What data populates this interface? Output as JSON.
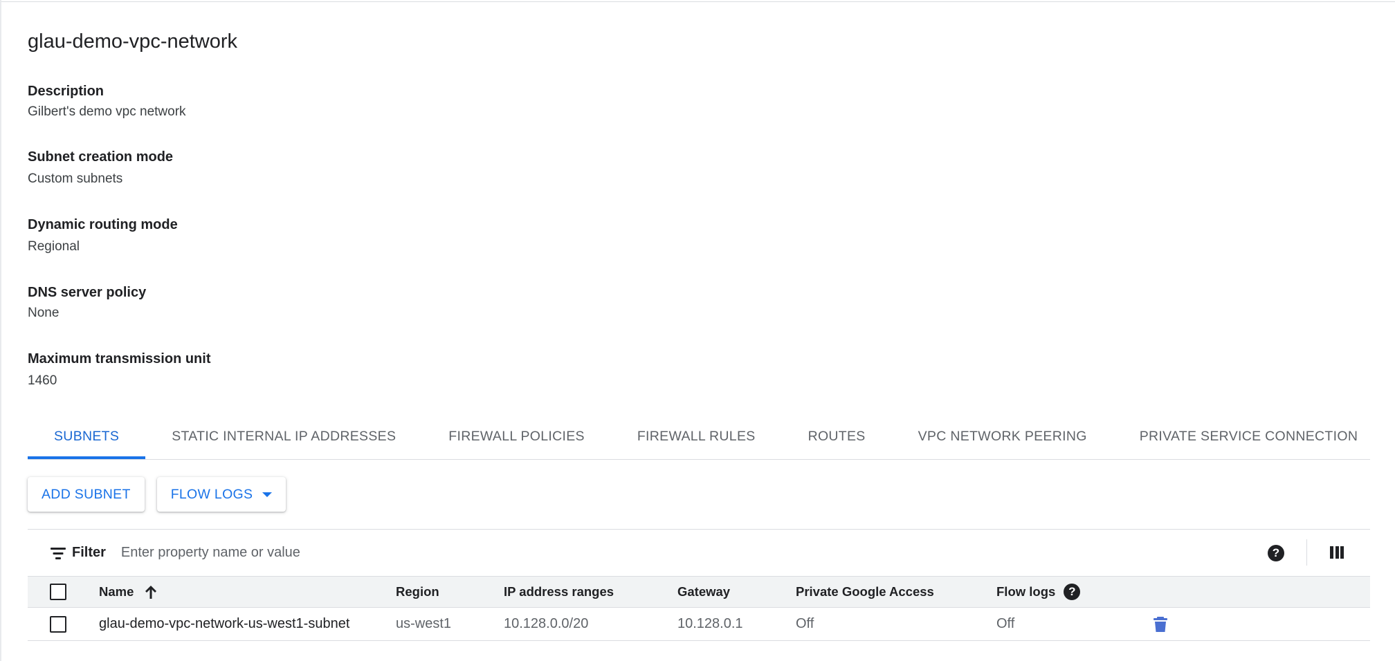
{
  "page": {
    "title": "glau-demo-vpc-network"
  },
  "properties": [
    {
      "label": "Description",
      "value": "Gilbert's demo vpc network"
    },
    {
      "label": "Subnet creation mode",
      "value": "Custom subnets"
    },
    {
      "label": "Dynamic routing mode",
      "value": "Regional"
    },
    {
      "label": "DNS server policy",
      "value": "None"
    },
    {
      "label": "Maximum transmission unit",
      "value": "1460"
    }
  ],
  "tabs": [
    {
      "label": "SUBNETS",
      "active": true
    },
    {
      "label": "STATIC INTERNAL IP ADDRESSES",
      "active": false
    },
    {
      "label": "FIREWALL POLICIES",
      "active": false
    },
    {
      "label": "FIREWALL RULES",
      "active": false
    },
    {
      "label": "ROUTES",
      "active": false
    },
    {
      "label": "VPC NETWORK PEERING",
      "active": false
    },
    {
      "label": "PRIVATE SERVICE CONNECTION",
      "active": false
    }
  ],
  "actions": {
    "add_subnet": "ADD SUBNET",
    "flow_logs": "FLOW LOGS"
  },
  "filter": {
    "label": "Filter",
    "placeholder": "Enter property name or value",
    "help_glyph": "?",
    "help_icon": "help-circle-icon",
    "columns_icon": "column-display-icon"
  },
  "table": {
    "columns": {
      "name": "Name",
      "region": "Region",
      "ip_ranges": "IP address ranges",
      "gateway": "Gateway",
      "private_google_access": "Private Google Access",
      "flow_logs": "Flow logs"
    },
    "sort": {
      "column": "name",
      "direction": "ascending",
      "icon": "arrow-up-icon"
    },
    "rows": [
      {
        "name": "glau-demo-vpc-network-us-west1-subnet",
        "region": "us-west1",
        "ip_ranges": "10.128.0.0/20",
        "gateway": "10.128.0.1",
        "private_google_access": "Off",
        "flow_logs": "Off",
        "action_icon": "trash-icon"
      }
    ]
  },
  "colors": {
    "accent": "#1a73e8",
    "delete_icon": "#4a6fd1",
    "header_bg": "#f1f3f4"
  }
}
